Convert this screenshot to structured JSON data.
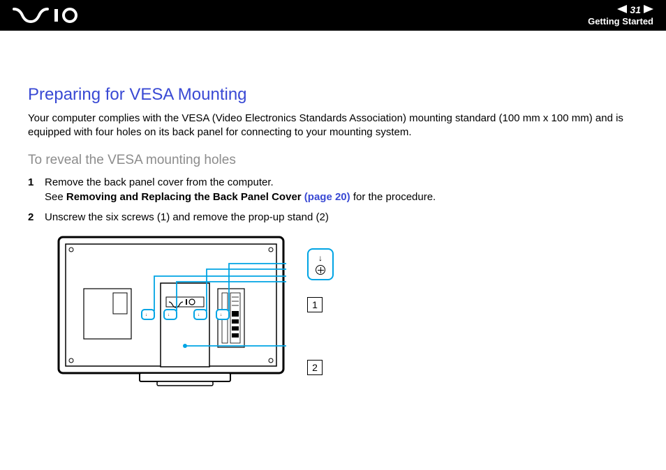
{
  "header": {
    "page_number": "31",
    "section": "Getting Started"
  },
  "page": {
    "title": "Preparing for VESA Mounting",
    "intro": "Your computer complies with the VESA (Video Electronics Standards Association) mounting standard (100 mm x 100 mm) and is equipped with four holes on its back panel for connecting to your mounting system.",
    "subtitle": "To reveal the VESA mounting holes",
    "steps": [
      {
        "line1": "Remove the back panel cover from the computer.",
        "line2_prefix": "See ",
        "line2_bold": "Removing and Replacing the Back Panel Cover ",
        "line2_link": "(page 20)",
        "line2_suffix": " for the procedure."
      },
      {
        "line1": "Unscrew the six screws (1) and remove the prop-up stand (2)"
      }
    ],
    "callouts": {
      "label1": "1",
      "label2": "2"
    }
  }
}
